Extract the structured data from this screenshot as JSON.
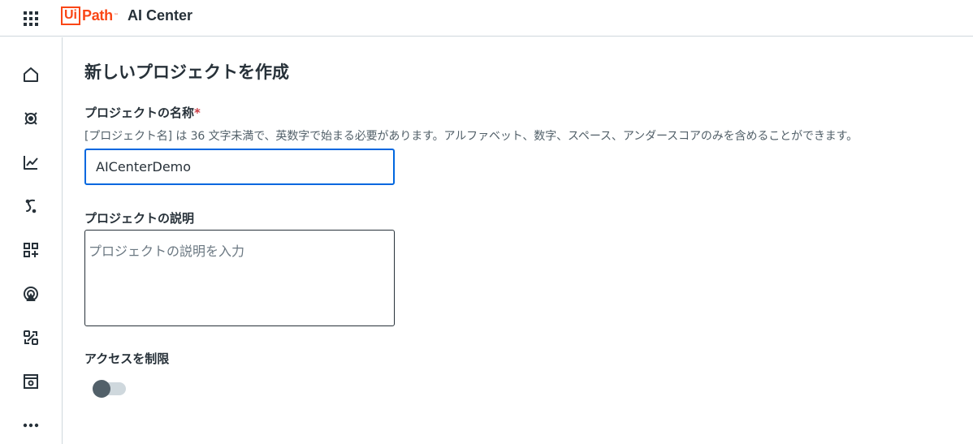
{
  "header": {
    "logo_ui": "Ui",
    "logo_path": "Path",
    "logo_tm": "™",
    "product": "AI Center"
  },
  "sidebar": {
    "items": [
      {
        "icon": "home-icon"
      },
      {
        "icon": "ml-skills-icon"
      },
      {
        "icon": "pipelines-icon"
      },
      {
        "icon": "packages-icon"
      },
      {
        "icon": "add-widgets-icon"
      },
      {
        "icon": "deployments-icon"
      },
      {
        "icon": "datasets-icon"
      },
      {
        "icon": "logs-icon"
      },
      {
        "icon": "more-icon"
      }
    ]
  },
  "form": {
    "title": "新しいプロジェクトを作成",
    "name_label": "プロジェクトの名称",
    "required_mark": "*",
    "name_help": "[プロジェクト名] は 36 文字未満で、英数字で始まる必要があります。アルファベット、数字、スペース、アンダースコアのみを含めることができます。",
    "name_value": "AICenterDemo",
    "description_label": "プロジェクトの説明",
    "description_placeholder": "プロジェクトの説明を入力",
    "restrict_access_label": "アクセスを制限",
    "restrict_access_on": false
  },
  "colors": {
    "brand": "#fa4616",
    "focus": "#0067df",
    "text": "#273139"
  }
}
